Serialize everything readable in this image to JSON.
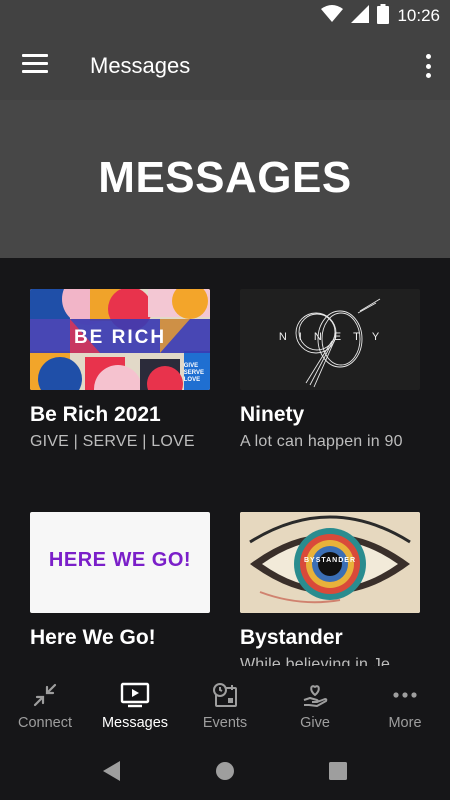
{
  "status_bar": {
    "time": "10:26"
  },
  "app_bar": {
    "title": "Messages"
  },
  "hero": {
    "title": "MESSAGES"
  },
  "cards": [
    {
      "title": "Be Rich 2021",
      "subtitle": "GIVE | SERVE | LOVE",
      "art_text": "BE RICH",
      "art_subtext": [
        "GIVE",
        "SERVE",
        "LOVE"
      ]
    },
    {
      "title": "Ninety",
      "subtitle": "A lot can happen in 90",
      "art_text": "NINETY",
      "art_number": "90"
    },
    {
      "title": "Here We Go!",
      "subtitle": "",
      "art_text": "HERE WE GO!"
    },
    {
      "title": "Bystander",
      "subtitle": "While believing in Je",
      "art_text": "BYSTANDER"
    }
  ],
  "bottom_nav": [
    {
      "label": "Connect",
      "icon": "connect-icon",
      "active": false
    },
    {
      "label": "Messages",
      "icon": "tv-play-icon",
      "active": true
    },
    {
      "label": "Events",
      "icon": "calendar-clock-icon",
      "active": false
    },
    {
      "label": "Give",
      "icon": "hand-heart-icon",
      "active": false
    },
    {
      "label": "More",
      "icon": "more-dots-icon",
      "active": false
    }
  ],
  "colors": {
    "bar": "#424242",
    "hero": "#474747",
    "background": "#161618",
    "accent_purple": "#7b1fc9"
  }
}
